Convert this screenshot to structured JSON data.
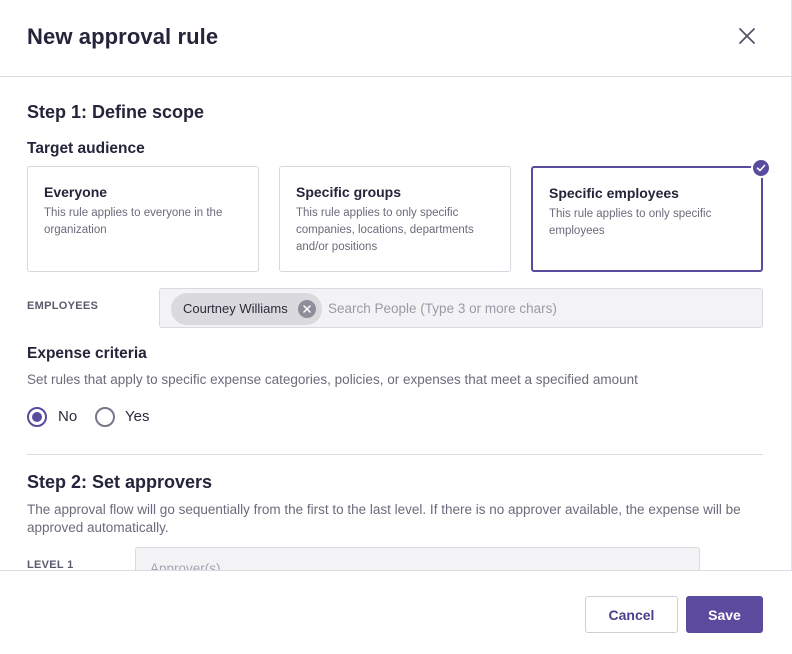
{
  "modal": {
    "title": "New approval rule",
    "close_icon": "close-icon"
  },
  "step1": {
    "heading": "Step 1: Define scope",
    "target_audience": {
      "label": "Target audience",
      "options": [
        {
          "title": "Everyone",
          "description": "This rule applies to everyone in the organization",
          "selected": false
        },
        {
          "title": "Specific groups",
          "description": "This rule applies to only specific companies, locations, departments and/or positions",
          "selected": false
        },
        {
          "title": "Specific employees",
          "description": "This rule applies to only specific employees",
          "selected": true
        }
      ],
      "selected_icon": "checkmark-circle-icon"
    },
    "employees": {
      "label": "EMPLOYEES",
      "chips": [
        "Courtney Williams"
      ],
      "remove_icon": "remove-chip-icon",
      "search_placeholder": "Search People (Type 3 or more chars)",
      "search_value": ""
    },
    "expense_criteria": {
      "heading": "Expense criteria",
      "description": "Set rules that apply to specific expense categories, policies, or expenses that meet a specified amount",
      "options": [
        {
          "label": "No",
          "checked": true
        },
        {
          "label": "Yes",
          "checked": false
        }
      ]
    }
  },
  "step2": {
    "heading": "Step 2: Set approvers",
    "description": "The approval flow will go sequentially from the first to the last level. If there is no approver available, the expense will be approved automatically.",
    "levels": [
      {
        "label": "LEVEL 1",
        "placeholder": "Approver(s)",
        "value": ""
      }
    ]
  },
  "footer": {
    "cancel_label": "Cancel",
    "save_label": "Save"
  },
  "colors": {
    "accent": "#5b4b9e",
    "border": "#d7d7df",
    "muted_text": "#6b6b7b"
  }
}
